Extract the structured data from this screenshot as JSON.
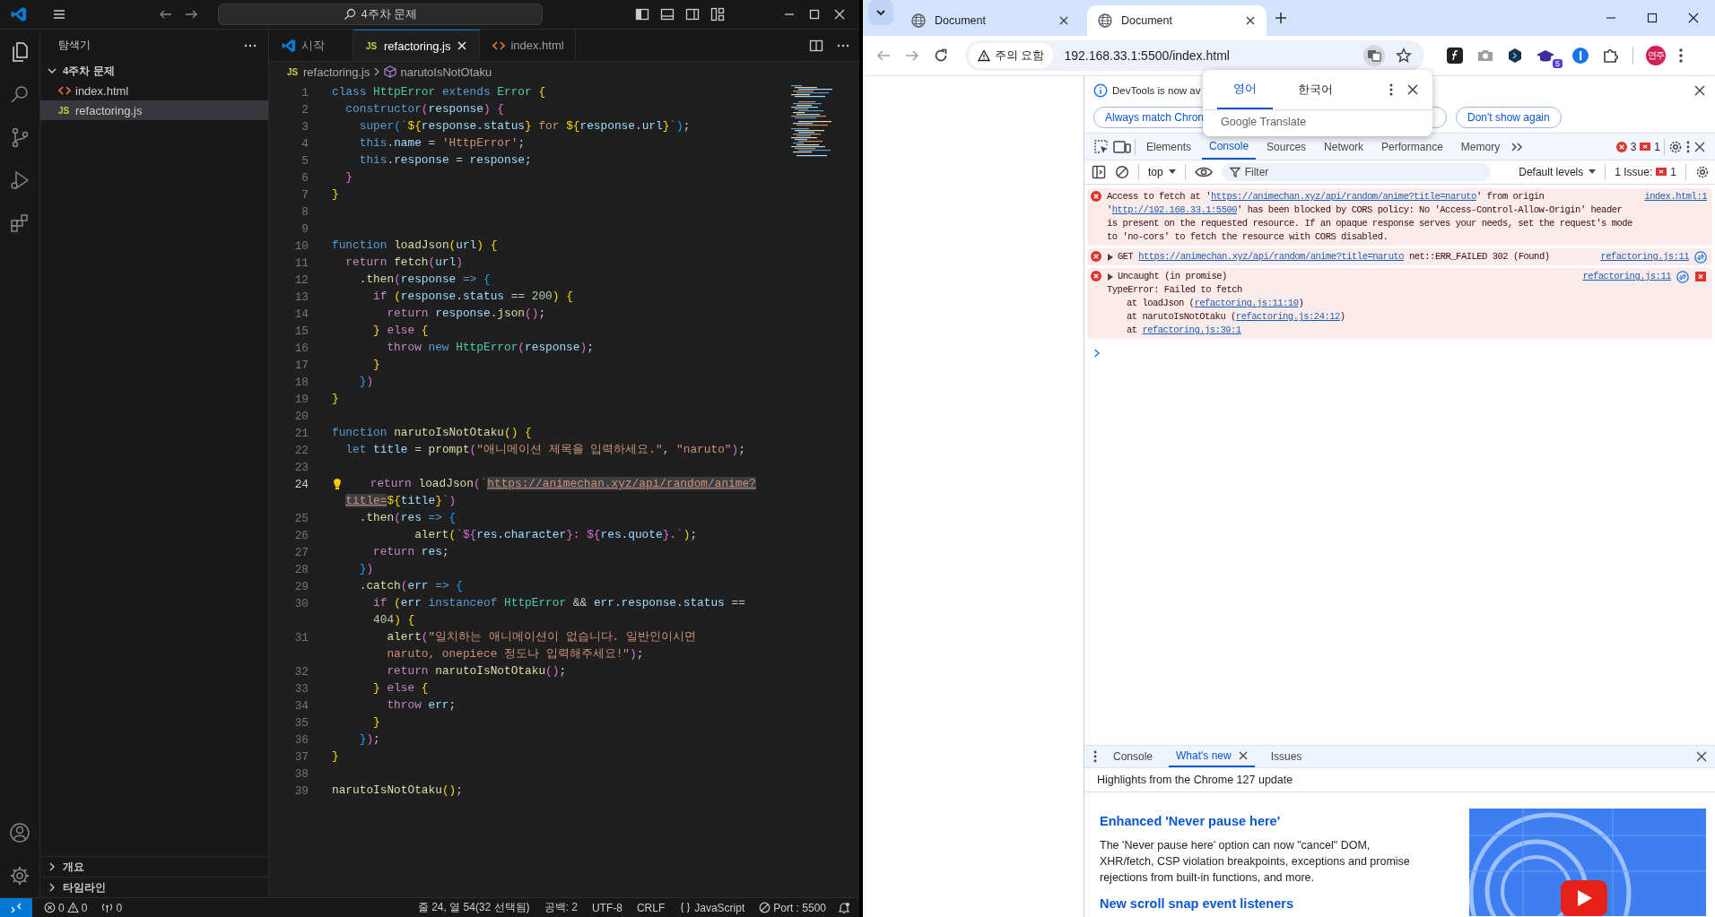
{
  "vscode": {
    "title_bar": {
      "command_center": "4주차 문제"
    },
    "sidebar": {
      "title": "탐색기",
      "folder": {
        "name": "4주차 문제",
        "expanded": true,
        "files": [
          {
            "name": "index.html",
            "kind": "html",
            "selected": false
          },
          {
            "name": "refactoring.js",
            "kind": "js",
            "icon_label": "JS",
            "selected": true
          }
        ]
      },
      "sections": [
        {
          "name": "개요",
          "expanded": false
        },
        {
          "name": "타임라인",
          "expanded": false
        }
      ]
    },
    "tabs": [
      {
        "label": "시작",
        "kind": "welcome",
        "selected": false
      },
      {
        "label": "refactoring.js",
        "kind": "js",
        "icon_label": "JS",
        "selected": true
      },
      {
        "label": "index.html",
        "kind": "html",
        "selected": false
      }
    ],
    "breadcrumbs": [
      {
        "label": "refactoring.js",
        "kind": "js",
        "icon_label": "JS"
      },
      {
        "label": "narutoIsNotOtaku",
        "kind": "symbol"
      }
    ],
    "editor": {
      "lines": [
        {
          "num": "1",
          "current": false,
          "rows": [
            [
              {
                "kind": "kw",
                "text": "class "
              },
              {
                "kind": "type",
                "text": "HttpError"
              },
              {
                "kind": "kw",
                "text": " extends "
              },
              {
                "kind": "type",
                "text": "Error"
              },
              {
                "kind": "plain",
                "text": " "
              },
              {
                "kind": "b1",
                "text": "{"
              }
            ]
          ]
        },
        {
          "num": "2",
          "current": false,
          "rows": [
            [
              {
                "kind": "plain",
                "text": "  "
              },
              {
                "kind": "kw",
                "text": "constructor"
              },
              {
                "kind": "b2",
                "text": "("
              },
              {
                "kind": "var",
                "text": "response"
              },
              {
                "kind": "b2",
                "text": ")"
              },
              {
                "kind": "plain",
                "text": " "
              },
              {
                "kind": "b2",
                "text": "{"
              }
            ]
          ]
        },
        {
          "num": "3",
          "current": false,
          "rows": [
            [
              {
                "kind": "plain",
                "text": "    "
              },
              {
                "kind": "kw",
                "text": "super"
              },
              {
                "kind": "b3",
                "text": "("
              },
              {
                "kind": "str",
                "text": "`"
              },
              {
                "kind": "b1",
                "text": "${"
              },
              {
                "kind": "var",
                "text": "response.status"
              },
              {
                "kind": "b1",
                "text": "}"
              },
              {
                "kind": "str",
                "text": " for "
              },
              {
                "kind": "b1",
                "text": "${"
              },
              {
                "kind": "var",
                "text": "response.url"
              },
              {
                "kind": "b1",
                "text": "}"
              },
              {
                "kind": "str",
                "text": "`"
              },
              {
                "kind": "b3",
                "text": ")"
              },
              {
                "kind": "plain",
                "text": ";"
              }
            ]
          ]
        },
        {
          "num": "4",
          "current": false,
          "rows": [
            [
              {
                "kind": "plain",
                "text": "    "
              },
              {
                "kind": "kw",
                "text": "this"
              },
              {
                "kind": "plain",
                "text": "."
              },
              {
                "kind": "var",
                "text": "name"
              },
              {
                "kind": "plain",
                "text": " = "
              },
              {
                "kind": "str",
                "text": "'HttpError'"
              },
              {
                "kind": "plain",
                "text": ";"
              }
            ]
          ]
        },
        {
          "num": "5",
          "current": false,
          "rows": [
            [
              {
                "kind": "plain",
                "text": "    "
              },
              {
                "kind": "kw",
                "text": "this"
              },
              {
                "kind": "plain",
                "text": "."
              },
              {
                "kind": "var",
                "text": "response"
              },
              {
                "kind": "plain",
                "text": " = "
              },
              {
                "kind": "var",
                "text": "response"
              },
              {
                "kind": "plain",
                "text": ";"
              }
            ]
          ]
        },
        {
          "num": "6",
          "current": false,
          "rows": [
            [
              {
                "kind": "plain",
                "text": "  "
              },
              {
                "kind": "b2",
                "text": "}"
              }
            ]
          ]
        },
        {
          "num": "7",
          "current": false,
          "rows": [
            [
              {
                "kind": "b1",
                "text": "}"
              }
            ]
          ]
        },
        {
          "num": "8",
          "current": false,
          "rows": [
            []
          ]
        },
        {
          "num": "9",
          "current": false,
          "rows": [
            []
          ]
        },
        {
          "num": "10",
          "current": false,
          "rows": [
            [
              {
                "kind": "kw",
                "text": "function "
              },
              {
                "kind": "fn",
                "text": "loadJson"
              },
              {
                "kind": "b1",
                "text": "("
              },
              {
                "kind": "var",
                "text": "url"
              },
              {
                "kind": "b1",
                "text": ")"
              },
              {
                "kind": "plain",
                "text": " "
              },
              {
                "kind": "b1",
                "text": "{"
              }
            ]
          ]
        },
        {
          "num": "11",
          "current": false,
          "rows": [
            [
              {
                "kind": "plain",
                "text": "  "
              },
              {
                "kind": "ctl",
                "text": "return "
              },
              {
                "kind": "fn",
                "text": "fetch"
              },
              {
                "kind": "b2",
                "text": "("
              },
              {
                "kind": "var",
                "text": "url"
              },
              {
                "kind": "b2",
                "text": ")"
              }
            ]
          ]
        },
        {
          "num": "12",
          "current": false,
          "rows": [
            [
              {
                "kind": "plain",
                "text": "    ."
              },
              {
                "kind": "fn",
                "text": "then"
              },
              {
                "kind": "b2",
                "text": "("
              },
              {
                "kind": "var",
                "text": "response"
              },
              {
                "kind": "kw",
                "text": " =>"
              },
              {
                "kind": "plain",
                "text": " "
              },
              {
                "kind": "b3",
                "text": "{"
              }
            ]
          ]
        },
        {
          "num": "13",
          "current": false,
          "rows": [
            [
              {
                "kind": "plain",
                "text": "      "
              },
              {
                "kind": "ctl",
                "text": "if"
              },
              {
                "kind": "plain",
                "text": " "
              },
              {
                "kind": "b1",
                "text": "("
              },
              {
                "kind": "var",
                "text": "response.status"
              },
              {
                "kind": "plain",
                "text": " == "
              },
              {
                "kind": "num",
                "text": "200"
              },
              {
                "kind": "b1",
                "text": ")"
              },
              {
                "kind": "plain",
                "text": " "
              },
              {
                "kind": "b1",
                "text": "{"
              }
            ]
          ]
        },
        {
          "num": "14",
          "current": false,
          "rows": [
            [
              {
                "kind": "plain",
                "text": "        "
              },
              {
                "kind": "ctl",
                "text": "return "
              },
              {
                "kind": "var",
                "text": "response"
              },
              {
                "kind": "plain",
                "text": "."
              },
              {
                "kind": "fn",
                "text": "json"
              },
              {
                "kind": "b2",
                "text": "()"
              },
              {
                "kind": "plain",
                "text": ";"
              }
            ]
          ]
        },
        {
          "num": "15",
          "current": false,
          "rows": [
            [
              {
                "kind": "plain",
                "text": "      "
              },
              {
                "kind": "b1",
                "text": "}"
              },
              {
                "kind": "ctl",
                "text": " else "
              },
              {
                "kind": "b1",
                "text": "{"
              }
            ]
          ]
        },
        {
          "num": "16",
          "current": false,
          "rows": [
            [
              {
                "kind": "plain",
                "text": "        "
              },
              {
                "kind": "ctl",
                "text": "throw "
              },
              {
                "kind": "kw",
                "text": "new "
              },
              {
                "kind": "type",
                "text": "HttpError"
              },
              {
                "kind": "b2",
                "text": "("
              },
              {
                "kind": "var",
                "text": "response"
              },
              {
                "kind": "b2",
                "text": ")"
              },
              {
                "kind": "plain",
                "text": ";"
              }
            ]
          ]
        },
        {
          "num": "17",
          "current": false,
          "rows": [
            [
              {
                "kind": "plain",
                "text": "      "
              },
              {
                "kind": "b1",
                "text": "}"
              }
            ]
          ]
        },
        {
          "num": "18",
          "current": false,
          "rows": [
            [
              {
                "kind": "plain",
                "text": "    "
              },
              {
                "kind": "b3",
                "text": "}"
              },
              {
                "kind": "b2",
                "text": ")"
              }
            ]
          ]
        },
        {
          "num": "19",
          "current": false,
          "rows": [
            [
              {
                "kind": "b1",
                "text": "}"
              }
            ]
          ]
        },
        {
          "num": "20",
          "current": false,
          "rows": [
            []
          ]
        },
        {
          "num": "21",
          "current": false,
          "rows": [
            [
              {
                "kind": "kw",
                "text": "function "
              },
              {
                "kind": "fn",
                "text": "narutoIsNotOtaku"
              },
              {
                "kind": "b1",
                "text": "()"
              },
              {
                "kind": "plain",
                "text": " "
              },
              {
                "kind": "b1",
                "text": "{"
              }
            ]
          ]
        },
        {
          "num": "22",
          "current": false,
          "rows": [
            [
              {
                "kind": "plain",
                "text": "  "
              },
              {
                "kind": "kw",
                "text": "let "
              },
              {
                "kind": "var",
                "text": "title"
              },
              {
                "kind": "plain",
                "text": " = "
              },
              {
                "kind": "fn",
                "text": "prompt"
              },
              {
                "kind": "b2",
                "text": "("
              },
              {
                "kind": "str",
                "text": "\"애니메이션 제목을 입력하세요.\""
              },
              {
                "kind": "plain",
                "text": ", "
              },
              {
                "kind": "str",
                "text": "\"naruto\""
              },
              {
                "kind": "b2",
                "text": ")"
              },
              {
                "kind": "plain",
                "text": ";"
              }
            ]
          ]
        },
        {
          "num": "23",
          "current": false,
          "rows": [
            []
          ]
        },
        {
          "num": "24",
          "current": true,
          "rows": [
            {
              "tokens": [
                {
                  "kind": "ctl",
                  "text": "    return "
                },
                {
                  "kind": "fn",
                  "text": "loadJson"
                },
                {
                  "kind": "b2",
                  "text": "("
                },
                {
                  "kind": "str",
                  "text": "`"
                },
                {
                  "kind": "url",
                  "text": "https://animechan.xyz/api/random/anime?"
                }
              ]
            },
            {
              "tokens": [
                {
                  "kind": "url",
                  "text": "  title="
                },
                {
                  "kind": "b1",
                  "text": "${"
                },
                {
                  "kind": "var",
                  "text": "title"
                },
                {
                  "kind": "b1",
                  "text": "}"
                },
                {
                  "kind": "str",
                  "text": "`"
                },
                {
                  "kind": "b2",
                  "text": ")"
                }
              ]
            }
          ]
        },
        {
          "num": "25",
          "current": false,
          "rows": [
            [
              {
                "kind": "plain",
                "text": "    ."
              },
              {
                "kind": "fn",
                "text": "then"
              },
              {
                "kind": "b2",
                "text": "("
              },
              {
                "kind": "var",
                "text": "res"
              },
              {
                "kind": "kw",
                "text": " =>"
              },
              {
                "kind": "plain",
                "text": " "
              },
              {
                "kind": "b3",
                "text": "{"
              }
            ]
          ]
        },
        {
          "num": "26",
          "current": false,
          "rows": [
            [
              {
                "kind": "plain",
                "text": "            "
              },
              {
                "kind": "fn",
                "text": "alert"
              },
              {
                "kind": "b1",
                "text": "("
              },
              {
                "kind": "str",
                "text": "`"
              },
              {
                "kind": "b2",
                "text": "${"
              },
              {
                "kind": "var",
                "text": "res.character"
              },
              {
                "kind": "b2",
                "text": "}"
              },
              {
                "kind": "str",
                "text": ": "
              },
              {
                "kind": "b2",
                "text": "${"
              },
              {
                "kind": "var",
                "text": "res.quote"
              },
              {
                "kind": "b2",
                "text": "}"
              },
              {
                "kind": "str",
                "text": ".`"
              },
              {
                "kind": "b1",
                "text": ")"
              },
              {
                "kind": "plain",
                "text": ";"
              }
            ]
          ]
        },
        {
          "num": "27",
          "current": false,
          "rows": [
            [
              {
                "kind": "plain",
                "text": "      "
              },
              {
                "kind": "ctl",
                "text": "return "
              },
              {
                "kind": "var",
                "text": "res"
              },
              {
                "kind": "plain",
                "text": ";"
              }
            ]
          ]
        },
        {
          "num": "28",
          "current": false,
          "rows": [
            [
              {
                "kind": "plain",
                "text": "    "
              },
              {
                "kind": "b3",
                "text": "}"
              },
              {
                "kind": "b2",
                "text": ")"
              }
            ]
          ]
        },
        {
          "num": "29",
          "current": false,
          "rows": [
            [
              {
                "kind": "plain",
                "text": "    ."
              },
              {
                "kind": "fn",
                "text": "catch"
              },
              {
                "kind": "b2",
                "text": "("
              },
              {
                "kind": "var",
                "text": "err"
              },
              {
                "kind": "kw",
                "text": " =>"
              },
              {
                "kind": "plain",
                "text": " "
              },
              {
                "kind": "b3",
                "text": "{"
              }
            ]
          ]
        },
        {
          "num": "30",
          "current": false,
          "rows": [
            {
              "tokens": [
                {
                  "kind": "ctl",
                  "text": "      if"
                },
                {
                  "kind": "b1",
                  "text": " ("
                },
                {
                  "kind": "var",
                  "text": "err"
                },
                {
                  "kind": "kw",
                  "text": " instanceof "
                },
                {
                  "kind": "type",
                  "text": "HttpError"
                },
                {
                  "kind": "plain",
                  "text": " && "
                },
                {
                  "kind": "var",
                  "text": "err.response.status"
                },
                {
                  "kind": "plain",
                  "text": " =="
                }
              ]
            },
            {
              "tokens": [
                {
                  "kind": "num",
                  "text": "      404"
                },
                {
                  "kind": "b1",
                  "text": ")"
                },
                {
                  "kind": "b1",
                  "text": " {"
                }
              ]
            }
          ]
        },
        {
          "num": "31",
          "current": false,
          "rows": [
            {
              "tokens": [
                {
                  "kind": "fn",
                  "text": "        alert"
                },
                {
                  "kind": "b2",
                  "text": "("
                },
                {
                  "kind": "str",
                  "text": "\"일치하는 애니메이션이 없습니다. 일반인이시면"
                }
              ]
            },
            {
              "tokens": [
                {
                  "kind": "str",
                  "text": "        naruto, onepiece 정도나 입력해주세요!\""
                },
                {
                  "kind": "b2",
                  "text": ")"
                },
                {
                  "kind": "plain",
                  "text": ";"
                }
              ]
            }
          ]
        },
        {
          "num": "32",
          "current": false,
          "rows": [
            [
              {
                "kind": "plain",
                "text": "        "
              },
              {
                "kind": "ctl",
                "text": "return "
              },
              {
                "kind": "fn",
                "text": "narutoIsNotOtaku"
              },
              {
                "kind": "b2",
                "text": "()"
              },
              {
                "kind": "plain",
                "text": ";"
              }
            ]
          ]
        },
        {
          "num": "33",
          "current": false,
          "rows": [
            [
              {
                "kind": "plain",
                "text": "      "
              },
              {
                "kind": "b1",
                "text": "}"
              },
              {
                "kind": "ctl",
                "text": " else "
              },
              {
                "kind": "b1",
                "text": "{"
              }
            ]
          ]
        },
        {
          "num": "34",
          "current": false,
          "rows": [
            [
              {
                "kind": "plain",
                "text": "        "
              },
              {
                "kind": "ctl",
                "text": "throw "
              },
              {
                "kind": "var",
                "text": "err"
              },
              {
                "kind": "plain",
                "text": ";"
              }
            ]
          ]
        },
        {
          "num": "35",
          "current": false,
          "rows": [
            [
              {
                "kind": "plain",
                "text": "      "
              },
              {
                "kind": "b1",
                "text": "}"
              }
            ]
          ]
        },
        {
          "num": "36",
          "current": false,
          "rows": [
            [
              {
                "kind": "plain",
                "text": "    "
              },
              {
                "kind": "b3",
                "text": "}"
              },
              {
                "kind": "b2",
                "text": ")"
              },
              {
                "kind": "plain",
                "text": ";"
              }
            ]
          ]
        },
        {
          "num": "37",
          "current": false,
          "rows": [
            [
              {
                "kind": "b1",
                "text": "}"
              }
            ]
          ]
        },
        {
          "num": "38",
          "current": false,
          "rows": [
            []
          ]
        },
        {
          "num": "39",
          "current": false,
          "rows": [
            [
              {
                "kind": "fn",
                "text": "narutoIsNotOtaku"
              },
              {
                "kind": "b1",
                "text": "()"
              },
              {
                "kind": "plain",
                "text": ";"
              }
            ]
          ]
        }
      ]
    },
    "status_bar": {
      "errors": "0",
      "warnings": "0",
      "ports": "0",
      "items": [
        {
          "kind": "text",
          "text": "줄 24, 열 54(32 선택됨)"
        },
        {
          "kind": "text",
          "text": "공백: 2"
        },
        {
          "kind": "text",
          "text": "UTF-8"
        },
        {
          "kind": "text",
          "text": "CRLF"
        },
        {
          "kind": "language",
          "text": "JavaScript"
        },
        {
          "kind": "port",
          "text": "Port : 5500"
        }
      ]
    }
  },
  "browser": {
    "tabs": [
      {
        "title": "Document",
        "selected": false
      },
      {
        "title": "Document",
        "selected": true
      }
    ],
    "address": {
      "security": "주의 요함",
      "url": "192.168.33.1:5500/index.html"
    },
    "extension_badge": "5",
    "profile": "연주",
    "translate_popup": {
      "languages": [
        {
          "label": "영어",
          "selected": true
        },
        {
          "label": "한국어",
          "selected": false
        }
      ],
      "brand": "Google Translate"
    },
    "devtools": {
      "infobar": {
        "message": "DevTools is now av",
        "buttons": [
          "Always match Chron",
          "Don't show again"
        ]
      },
      "panels": [
        {
          "label": "Elements",
          "selected": false
        },
        {
          "label": "Console",
          "selected": true
        },
        {
          "label": "Sources",
          "selected": false
        },
        {
          "label": "Network",
          "selected": false
        },
        {
          "label": "Performance",
          "selected": false
        },
        {
          "label": "Memory",
          "selected": false
        }
      ],
      "error_count": "3",
      "issue_count": "1",
      "console_toolbar": {
        "context": "top",
        "filter": {
          "placeholder": "Filter"
        },
        "levels": "Default levels",
        "issues_label": "1 Issue:",
        "issues_count": "1"
      },
      "messages": [
        {
          "kind": "error",
          "expandable": false,
          "source": "index.html:1",
          "parts": [
            {
              "kind": "text",
              "text": "Access to fetch at '"
            },
            {
              "kind": "link",
              "text": "https://animechan.xyz/api/random/anime?title=naruto"
            },
            {
              "kind": "text",
              "text": "' from origin '"
            },
            {
              "kind": "link",
              "text": "http://192.168.33.1:5500"
            },
            {
              "kind": "text",
              "text": "' has been blocked by CORS policy: No 'Access-Control-Allow-Origin' header is present on the requested resource. If an opaque response serves your needs, set the request's mode to 'no-cors' to fetch the resource with CORS disabled."
            }
          ]
        },
        {
          "kind": "error",
          "expandable": true,
          "badges": [
            {
              "kind": "network"
            }
          ],
          "source": "refactoring.js:11",
          "parts": [
            {
              "kind": "text",
              "text": "GET "
            },
            {
              "kind": "link",
              "text": "https://animechan.xyz/api/random/anime?title=naruto"
            },
            {
              "kind": "text",
              "text": " net::ERR_FAILED 302 (Found)"
            }
          ]
        },
        {
          "kind": "error",
          "expandable": true,
          "badges": [
            {
              "kind": "network"
            },
            {
              "kind": "issue"
            }
          ],
          "source": "refactoring.js:11",
          "parts": [
            {
              "kind": "text",
              "text": "Uncaught (in promise)"
            }
          ],
          "stack": [
            {
              "kind": "error_line",
              "parts": [
                {
                  "kind": "text",
                  "text": "TypeError: Failed to fetch"
                }
              ]
            },
            {
              "kind": "frame",
              "parts": [
                {
                  "kind": "text",
                  "text": "at loadJson ("
                },
                {
                  "kind": "link",
                  "text": "refactoring.js:11:10"
                },
                {
                  "kind": "text",
                  "text": ")"
                }
              ]
            },
            {
              "kind": "frame",
              "parts": [
                {
                  "kind": "text",
                  "text": "at narutoIsNotOtaku ("
                },
                {
                  "kind": "link",
                  "text": "refactoring.js:24:12"
                },
                {
                  "kind": "text",
                  "text": ")"
                }
              ]
            },
            {
              "kind": "frame",
              "parts": [
                {
                  "kind": "text",
                  "text": "at "
                },
                {
                  "kind": "link",
                  "text": "refactoring.js:39:1"
                }
              ]
            }
          ]
        }
      ],
      "drawer": {
        "tabs": [
          {
            "label": "Console",
            "selected": false,
            "closable": false
          },
          {
            "label": "What's new",
            "selected": true,
            "closable": true
          },
          {
            "label": "Issues",
            "selected": false,
            "closable": false
          }
        ],
        "subtitle": "Highlights from the Chrome 127 update",
        "articles": [
          {
            "title": "Enhanced 'Never pause here'",
            "body": "The 'Never pause here' option can now \"cancel\" DOM, XHR/fetch, CSP violation breakpoints, exceptions and promise rejections from built-in functions, and more."
          },
          {
            "title": "New scroll snap event listeners"
          }
        ]
      }
    }
  }
}
